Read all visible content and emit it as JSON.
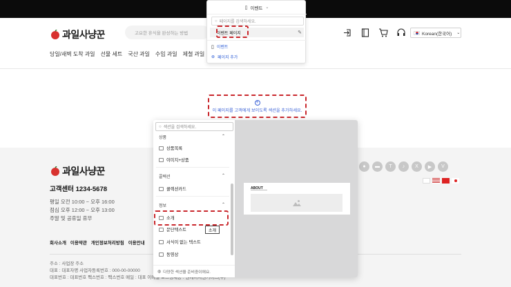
{
  "header": {
    "logo_text": "과일사냥꾼",
    "search_placeholder": "고요한 휴식을 완성하는 방법",
    "language_label": "Korean(한국어)",
    "nav": [
      "당일/새벽 도착 과일",
      "선물 세트",
      "국산 과일",
      "수입 과일",
      "제철 과일",
      "직"
    ]
  },
  "page_dropdown": {
    "title": "이벤트",
    "search_placeholder": "페이지를 검색하세요.",
    "active_item": "이벤트 페이지",
    "items": [
      {
        "label": "이벤트",
        "icon": "page-icon"
      },
      {
        "label": "페이지 추가",
        "icon": "add-circle-icon"
      }
    ]
  },
  "add_section": {
    "label": "이 페이지를 고객에게 보이도록 섹션을 추가하세요."
  },
  "footer": {
    "logo_text": "과일사냥꾼",
    "customer_center": "고객센터 1234-5678",
    "hours": [
      "평일 오전 10:00 ~ 오후 16:00",
      "점심 오후 12:00 ~ 오후 13:00",
      "주말 및 공휴일 휴무"
    ],
    "links": [
      "회사소개",
      "이용약관",
      "개인정보처리방침",
      "이용안내"
    ],
    "info": [
      "주소 : 사업장 주소",
      "대표 : 대표자명    사업자등록번호 : 000-00-00000",
      "대표번호 : 대표번호    팩스번호 : 팩스번호    메일 : 대표 이메일    호스팅제공 : 엔에이치엔커머스(주)"
    ],
    "social_icons": [
      "chat-icon",
      "message-icon",
      "talk-icon",
      "tiktok-icon",
      "x-icon",
      "youtube-icon",
      "vimeo-icon"
    ]
  },
  "section_panel": {
    "search_placeholder": "섹션을 검색하세요.",
    "groups": [
      {
        "label": "상품",
        "items": [
          "상품목록",
          "이미지+상품"
        ]
      },
      {
        "label": "콜렉션",
        "items": [
          "콜렉션카드"
        ]
      },
      {
        "label": "정보",
        "items": [
          "소개",
          "문단텍스트",
          "서식이 없는 텍스트",
          "동영상"
        ]
      }
    ],
    "hint": "다양한 섹션을 준비중이에요.",
    "tooltip": "소개",
    "preview": {
      "title": "ABOUT"
    }
  },
  "colors": {
    "accent_blue": "#2f5fd6",
    "highlight_red": "#c9262b",
    "logo_red": "#d8322f"
  }
}
